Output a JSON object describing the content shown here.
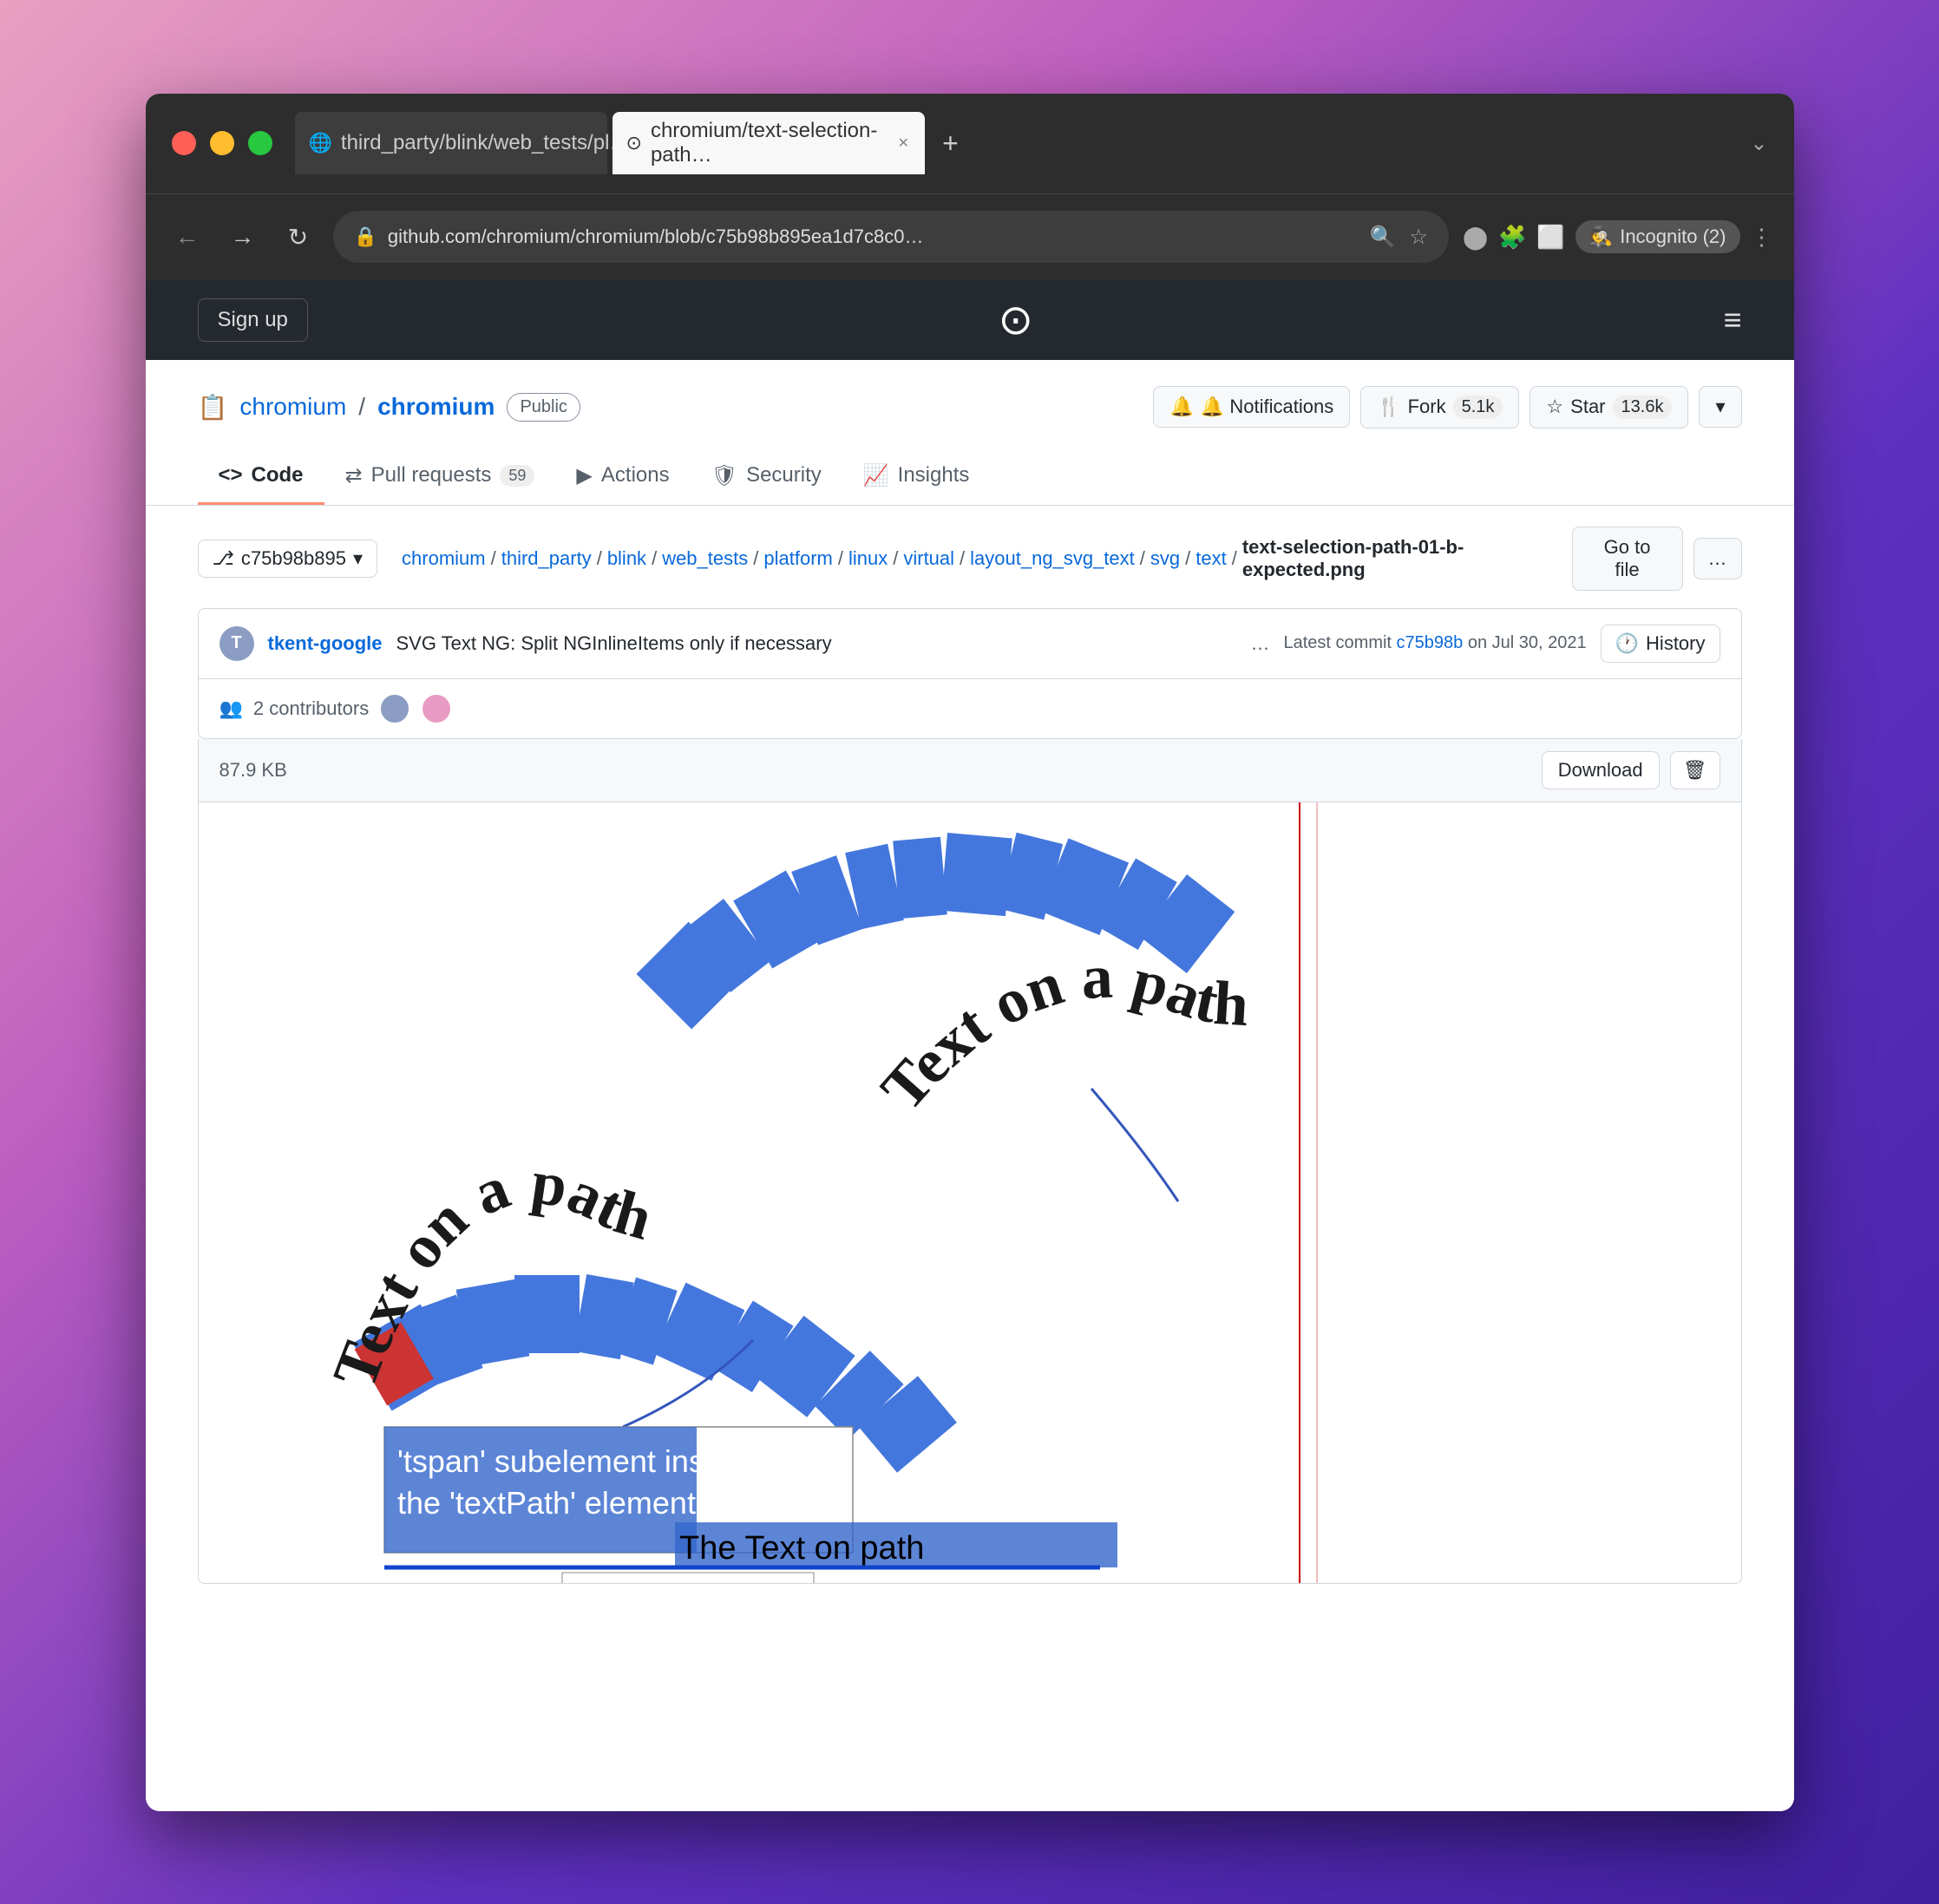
{
  "desktop": {
    "background": "gradient purple-pink"
  },
  "browser": {
    "tabs": [
      {
        "id": "tab1",
        "label": "third_party/blink/web_tests/pl…",
        "active": false,
        "favicon": "globe"
      },
      {
        "id": "tab2",
        "label": "chromium/text-selection-path…",
        "active": true,
        "favicon": "github"
      }
    ],
    "new_tab_label": "+",
    "window_chevron": "⌄",
    "nav": {
      "back": "←",
      "forward": "→",
      "refresh": "↻",
      "address": "github.com/chromium/chromium/blob/c75b98b895ea1d7c8c0…",
      "search_icon": "🔍",
      "star_icon": "☆",
      "profile_icon": "●",
      "extensions_icon": "🧩",
      "sidebar_icon": "⬜",
      "incognito_label": "Incognito (2)",
      "more_icon": "⋮"
    }
  },
  "github": {
    "header": {
      "signup_label": "Sign up",
      "logo": "⊙",
      "hamburger": "≡"
    },
    "repo": {
      "icon": "📋",
      "owner": "chromium",
      "slash": "/",
      "name": "chromium",
      "visibility": "Public",
      "notifications_label": "🔔 Notifications",
      "fork_label": "🍴 Fork",
      "fork_count": "5.1k",
      "star_label": "☆ Star",
      "star_count": "13.6k",
      "dropdown_arrow": "▾"
    },
    "tabs": [
      {
        "id": "code",
        "label": "Code",
        "active": true,
        "icon": "<>"
      },
      {
        "id": "pull_requests",
        "label": "Pull requests",
        "active": false,
        "icon": "⇄",
        "badge": "59"
      },
      {
        "id": "actions",
        "label": "Actions",
        "active": false,
        "icon": "▶"
      },
      {
        "id": "security",
        "label": "Security",
        "active": false,
        "icon": "🛡"
      },
      {
        "id": "insights",
        "label": "Insights",
        "active": false,
        "icon": "📈"
      }
    ],
    "breadcrumb": {
      "branch": "c75b98b895",
      "branch_icon": "⎇",
      "parts": [
        "chromium",
        "third_party",
        "blink",
        "web_tests",
        "platform",
        "linux",
        "virtual",
        "layout_ng_svg_text",
        "svg",
        "text"
      ],
      "filename": "text-selection-path-01-b-expected.png"
    },
    "go_to_file_label": "Go to file",
    "more_label": "…",
    "commit": {
      "avatar_initials": "T",
      "author": "tkent-google",
      "message": "SVG Text NG: Split NGInlineItems only if necessary",
      "ellipsis": "…",
      "hash_label": "Latest commit",
      "hash": "c75b98b",
      "date": "on Jul 30, 2021",
      "history_icon": "🕐",
      "history_label": "History"
    },
    "contributors": {
      "label": "2 contributors",
      "icon": "👥"
    },
    "file": {
      "size": "87.9 KB",
      "download_label": "Download",
      "delete_icon": "🗑"
    }
  }
}
